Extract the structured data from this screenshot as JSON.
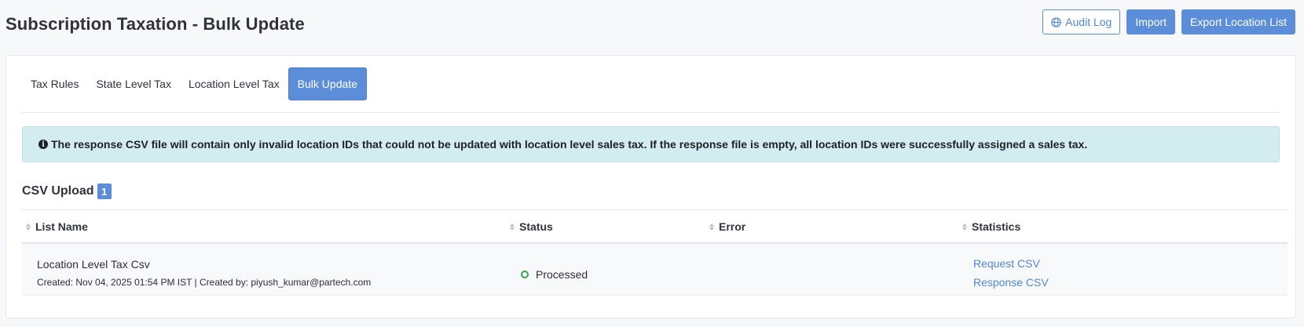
{
  "page": {
    "title": "Subscription Taxation - Bulk Update"
  },
  "header_actions": {
    "audit_log": "Audit Log",
    "import": "Import",
    "export": "Export Location List"
  },
  "tabs": [
    {
      "label": "Tax Rules",
      "active": false
    },
    {
      "label": "State Level Tax",
      "active": false
    },
    {
      "label": "Location Level Tax",
      "active": false
    },
    {
      "label": "Bulk Update",
      "active": true
    }
  ],
  "alert": {
    "icon": "info-icon",
    "text": "The response CSV file will contain only invalid location IDs that could not be updated with location level sales tax. If the response file is empty, all location IDs were successfully assigned a sales tax."
  },
  "section": {
    "title": "CSV Upload",
    "count": "1"
  },
  "table": {
    "columns": [
      "List Name",
      "Status",
      "Error",
      "Statistics"
    ],
    "rows": [
      {
        "list_name": "Location Level Tax Csv",
        "meta": "Created: Nov 04, 2025 01:54 PM IST | Created by: piyush_kumar@partech.com",
        "status": "Processed",
        "error": "",
        "stats": [
          "Request CSV",
          "Response CSV"
        ]
      }
    ]
  },
  "colors": {
    "accent": "#5b8dd9",
    "status_ok": "#2fa84f",
    "alert_bg": "#d3ecef"
  }
}
